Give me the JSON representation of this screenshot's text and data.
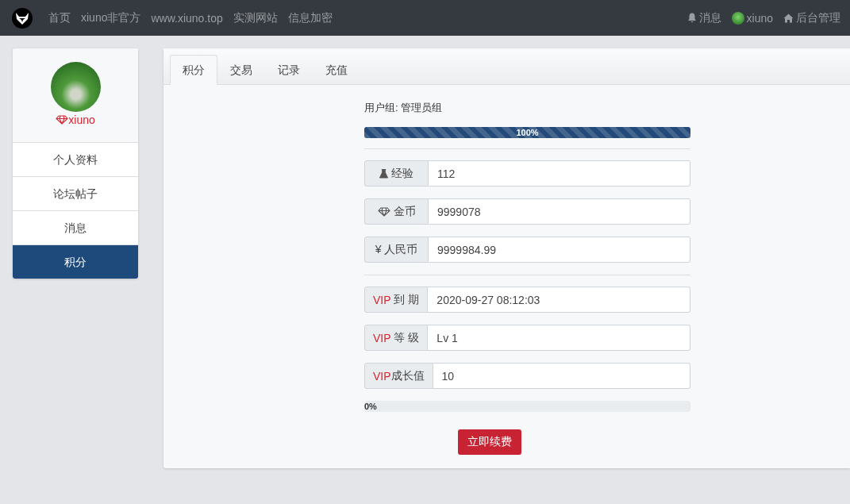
{
  "navbar": {
    "links": [
      "首页",
      "xiuno非官方",
      "www.xiuno.top",
      "实测网站",
      "信息加密"
    ],
    "right": [
      {
        "kind": "bell",
        "label": "消息"
      },
      {
        "kind": "avatar",
        "label": "xiuno"
      },
      {
        "kind": "home",
        "label": "后台管理"
      }
    ]
  },
  "sidebar": {
    "username": "xiuno",
    "items": [
      {
        "label": "个人资料",
        "selected": false
      },
      {
        "label": "论坛帖子",
        "selected": false
      },
      {
        "label": "消息",
        "selected": false
      },
      {
        "label": "积分",
        "selected": true
      }
    ]
  },
  "tabs": [
    {
      "label": "积分",
      "selected": true
    },
    {
      "label": "交易",
      "selected": false
    },
    {
      "label": "记录",
      "selected": false
    },
    {
      "label": "充值",
      "selected": false
    }
  ],
  "user_group": "用户组: 管理员组",
  "group_progress": {
    "level": 1,
    "reading": "100%"
  },
  "points": [
    {
      "kind": "flask",
      "label": "经验",
      "value": "112"
    },
    {
      "kind": "diamond",
      "label": "金币",
      "value": "9999078"
    },
    {
      "kind": "plain",
      "label": "¥ 人民币",
      "value": "9999984.99"
    }
  ],
  "vip": [
    {
      "prefix": "VIP",
      "label": "到 期",
      "value": "2020-09-27 08:12:03"
    },
    {
      "prefix": "VIP",
      "label": "等 级",
      "value": "Lv 1"
    },
    {
      "prefix": "VIP",
      "label": "成长值",
      "value": "10"
    }
  ],
  "vip_progress": {
    "level": 0,
    "reading": "0%"
  },
  "renew_button": "立即续费"
}
